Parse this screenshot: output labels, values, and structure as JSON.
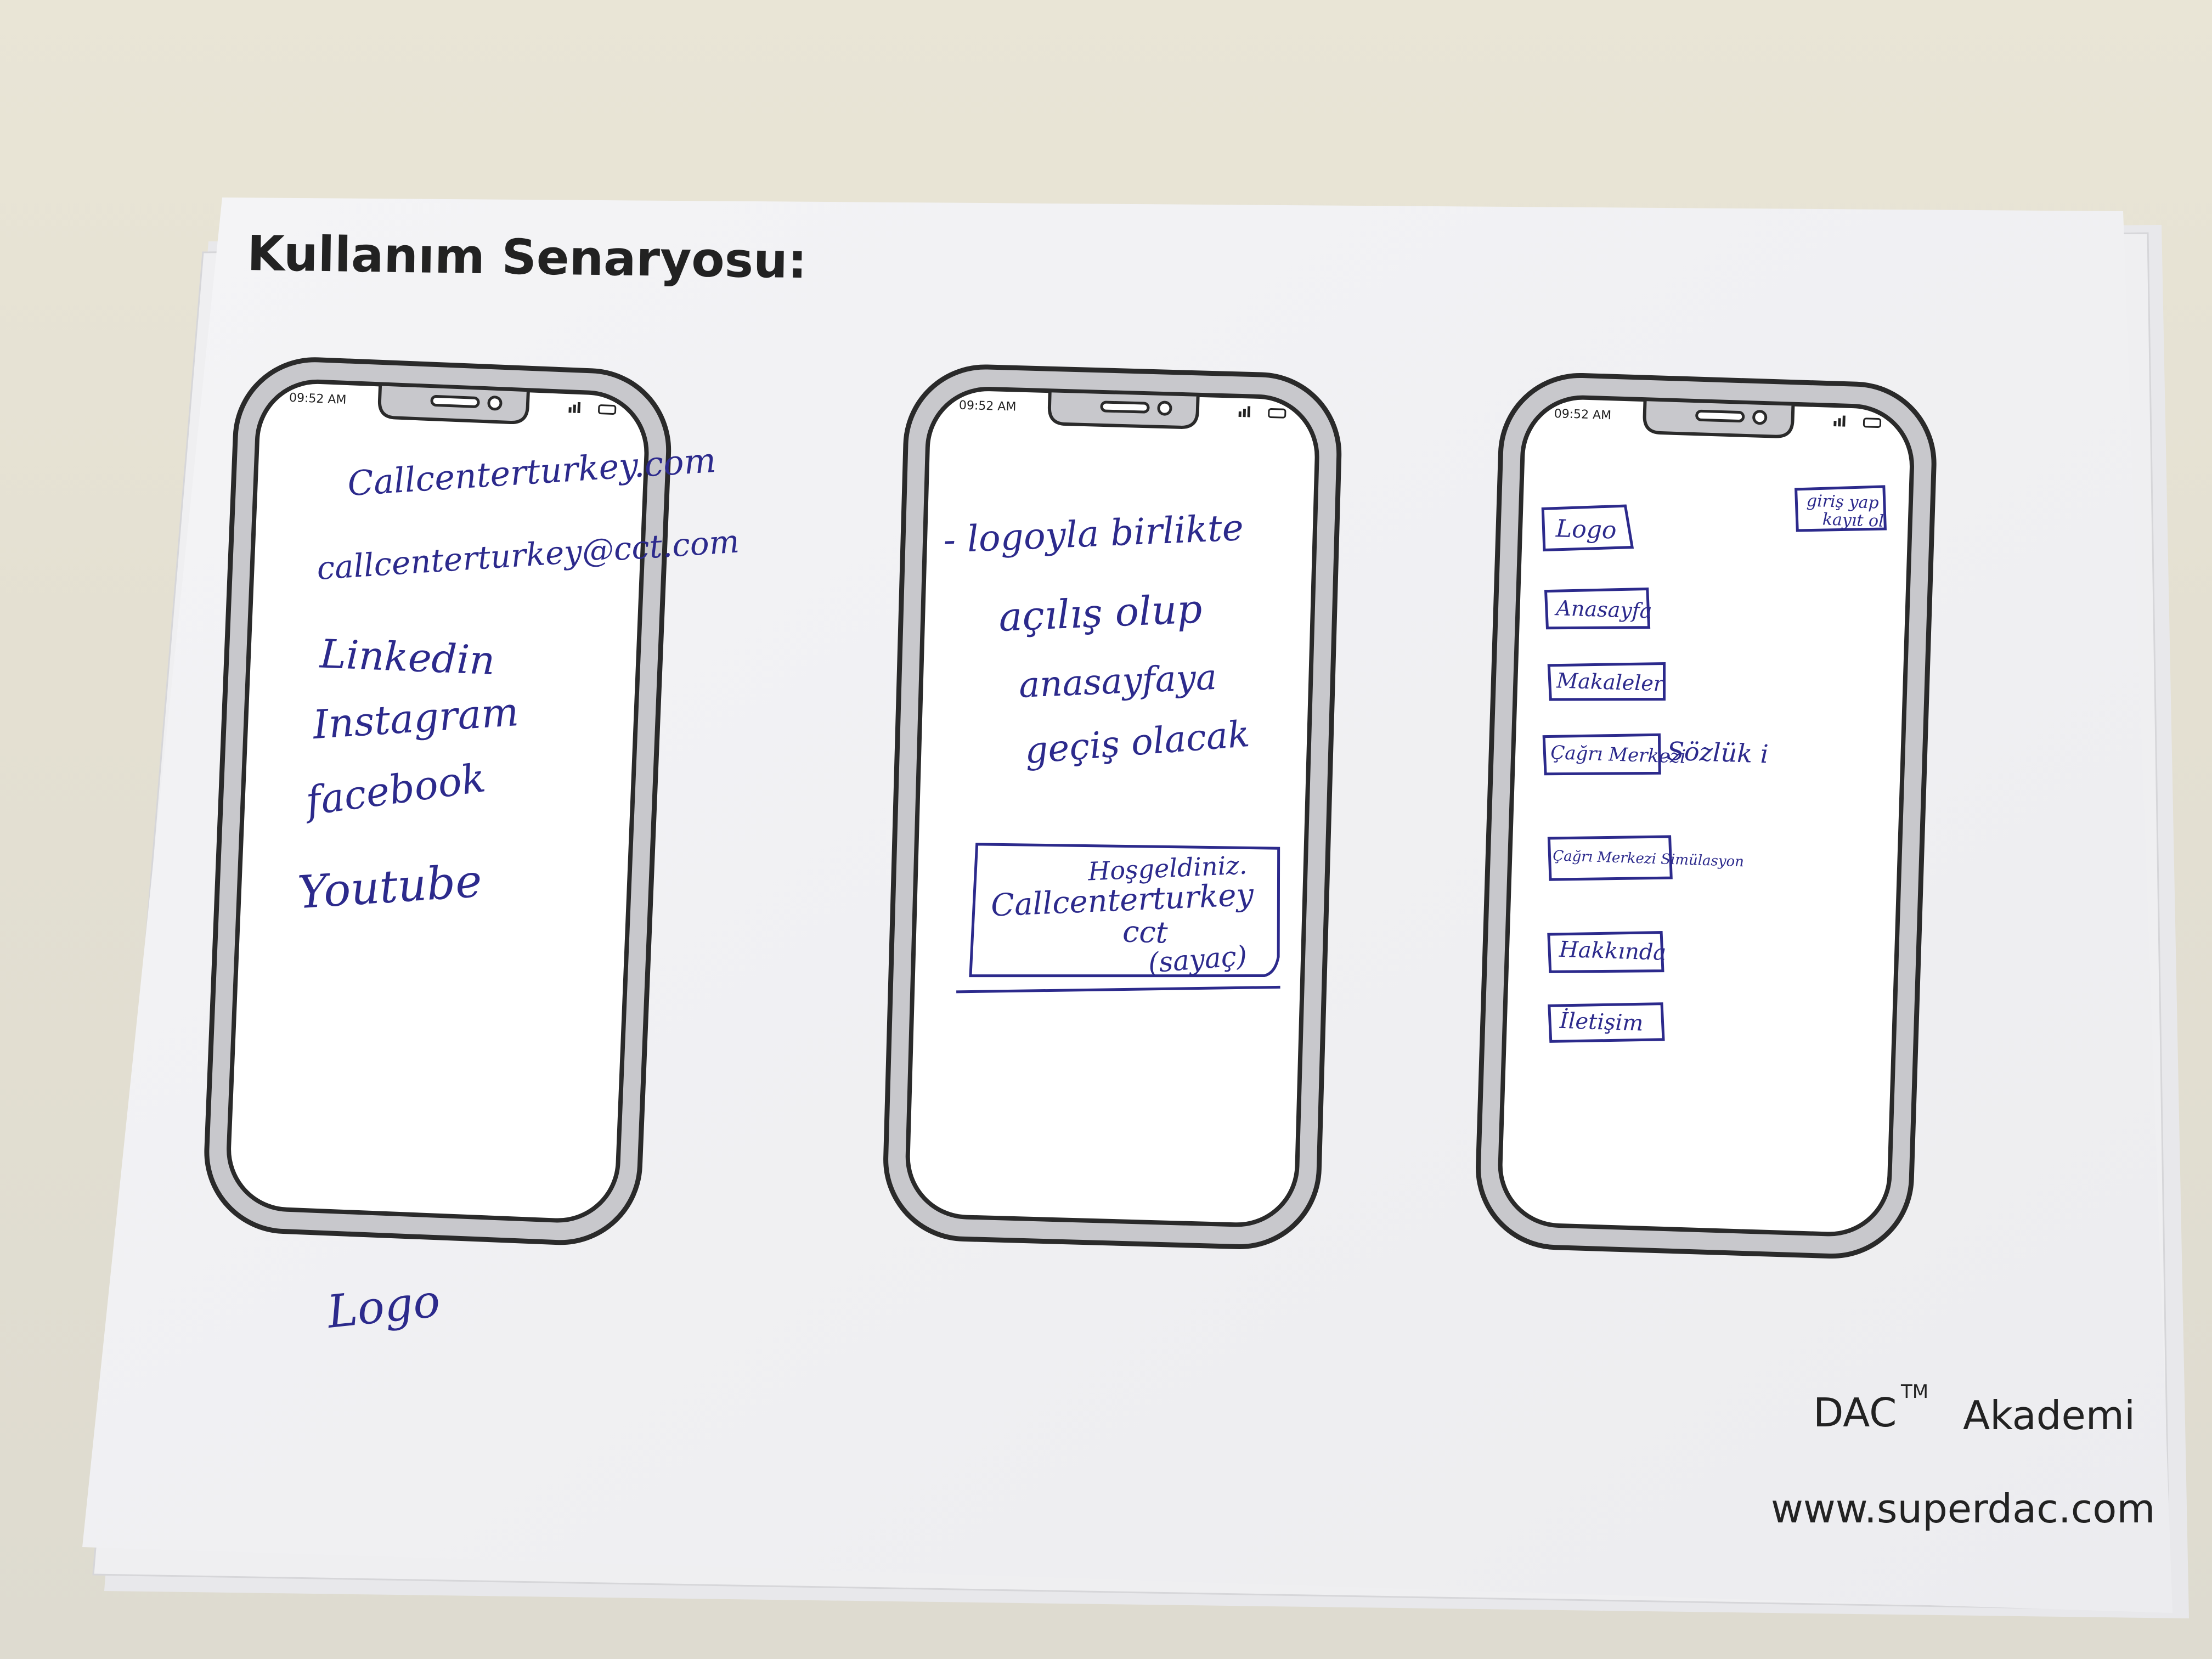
{
  "sheet": {
    "title": "Kullanım Senaryosu:",
    "brand": "DAC",
    "brand_tm": "TM",
    "brand_suffix": "Akademi",
    "website": "www.superdac.com"
  },
  "phones": [
    {
      "status_time": "09:52 AM",
      "lines": [
        "Callcenterturkey.com",
        "callcenterturkey@cct.com",
        "Linkedin",
        "Instagram",
        "facebook",
        "Youtube"
      ],
      "below_note": "Logo"
    },
    {
      "status_time": "09:52 AM",
      "lines": [
        "- logoyla birlikte",
        "açılış olup",
        "anasayfaya",
        "geçiş olacak"
      ],
      "box_lines": [
        "Hoşgeldiniz.",
        "Callcenterturkey",
        "cct",
        "(sayaç)"
      ]
    },
    {
      "status_time": "09:52 AM",
      "logo_box": "Logo",
      "login_box": [
        "giriş yap",
        "kayıt ol"
      ],
      "menu": [
        "Anasayfa",
        "Makaleler",
        "Çağrı Merkezi",
        "Çağrı Merkezi Simülasyon",
        "Hakkında",
        "İletişim"
      ],
      "menu_side_note": "Sözlük i"
    }
  ]
}
